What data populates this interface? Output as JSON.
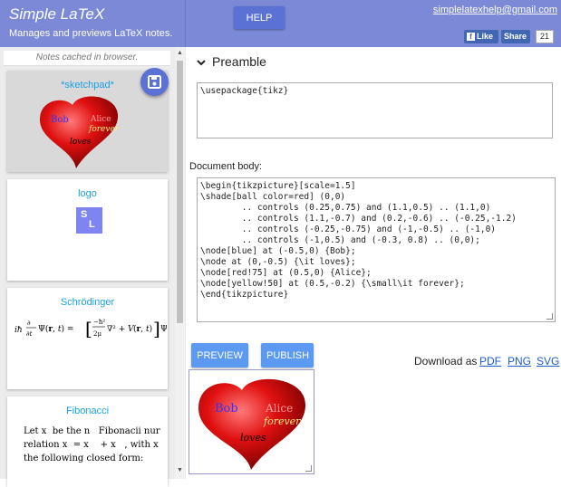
{
  "header": {
    "title": "Simple LaTeX",
    "subtitle": "Manages and previews LaTeX notes.",
    "help_label": "HELP",
    "email": "simplelatexhelp@gmail.com",
    "fb_like": "Like",
    "fb_share": "Share",
    "fb_count": "21"
  },
  "sidebar": {
    "cached_note": "Notes cached in browser.",
    "notes": [
      {
        "title": "*sketchpad*"
      },
      {
        "title": "logo"
      },
      {
        "title": "Schrödinger"
      },
      {
        "title": "Fibonacci"
      }
    ],
    "logo_s": "S",
    "logo_l": "L",
    "fib_lines": "Let x  be the n   Fibonacii nur\nrelation x  = x    + x   , with x\nthe following closed form:"
  },
  "heart": {
    "bob": "Bob",
    "alice": "Alice",
    "forever": "forever",
    "loves": "loves"
  },
  "main": {
    "preamble_label": "Preamble",
    "preamble_code": "\\usepackage{tikz}",
    "doc_label": "Document body:",
    "doc_code": "\\begin{tikzpicture}[scale=1.5]\n\\shade[ball color=red] (0,0)\n        .. controls (0.25,0.75) and (1.1,0.5) .. (1.1,0)\n        .. controls (1.1,-0.7) and (0.2,-0.6) .. (-0.25,-1.2)\n        .. controls (-0.25,-0.75) and (-1,-0.5) .. (-1,0)\n        .. controls (-1,0.5) and (-0.3, 0.8) .. (0,0);\n\\node[blue] at (-0.5,0) {Bob};\n\\node at (0,-0.5) {\\it loves};\n\\node[red!75] at (0.5,0) {Alice};\n\\node[yellow!50] at (0.5,-0.2) {\\small\\it forever};\n\\end{tikzpicture}",
    "preview_label": "PREVIEW",
    "publish_label": "PUBLISH",
    "download_label": "Download as",
    "download_pdf": "PDF",
    "download_png": "PNG",
    "download_svg": "SVG"
  }
}
